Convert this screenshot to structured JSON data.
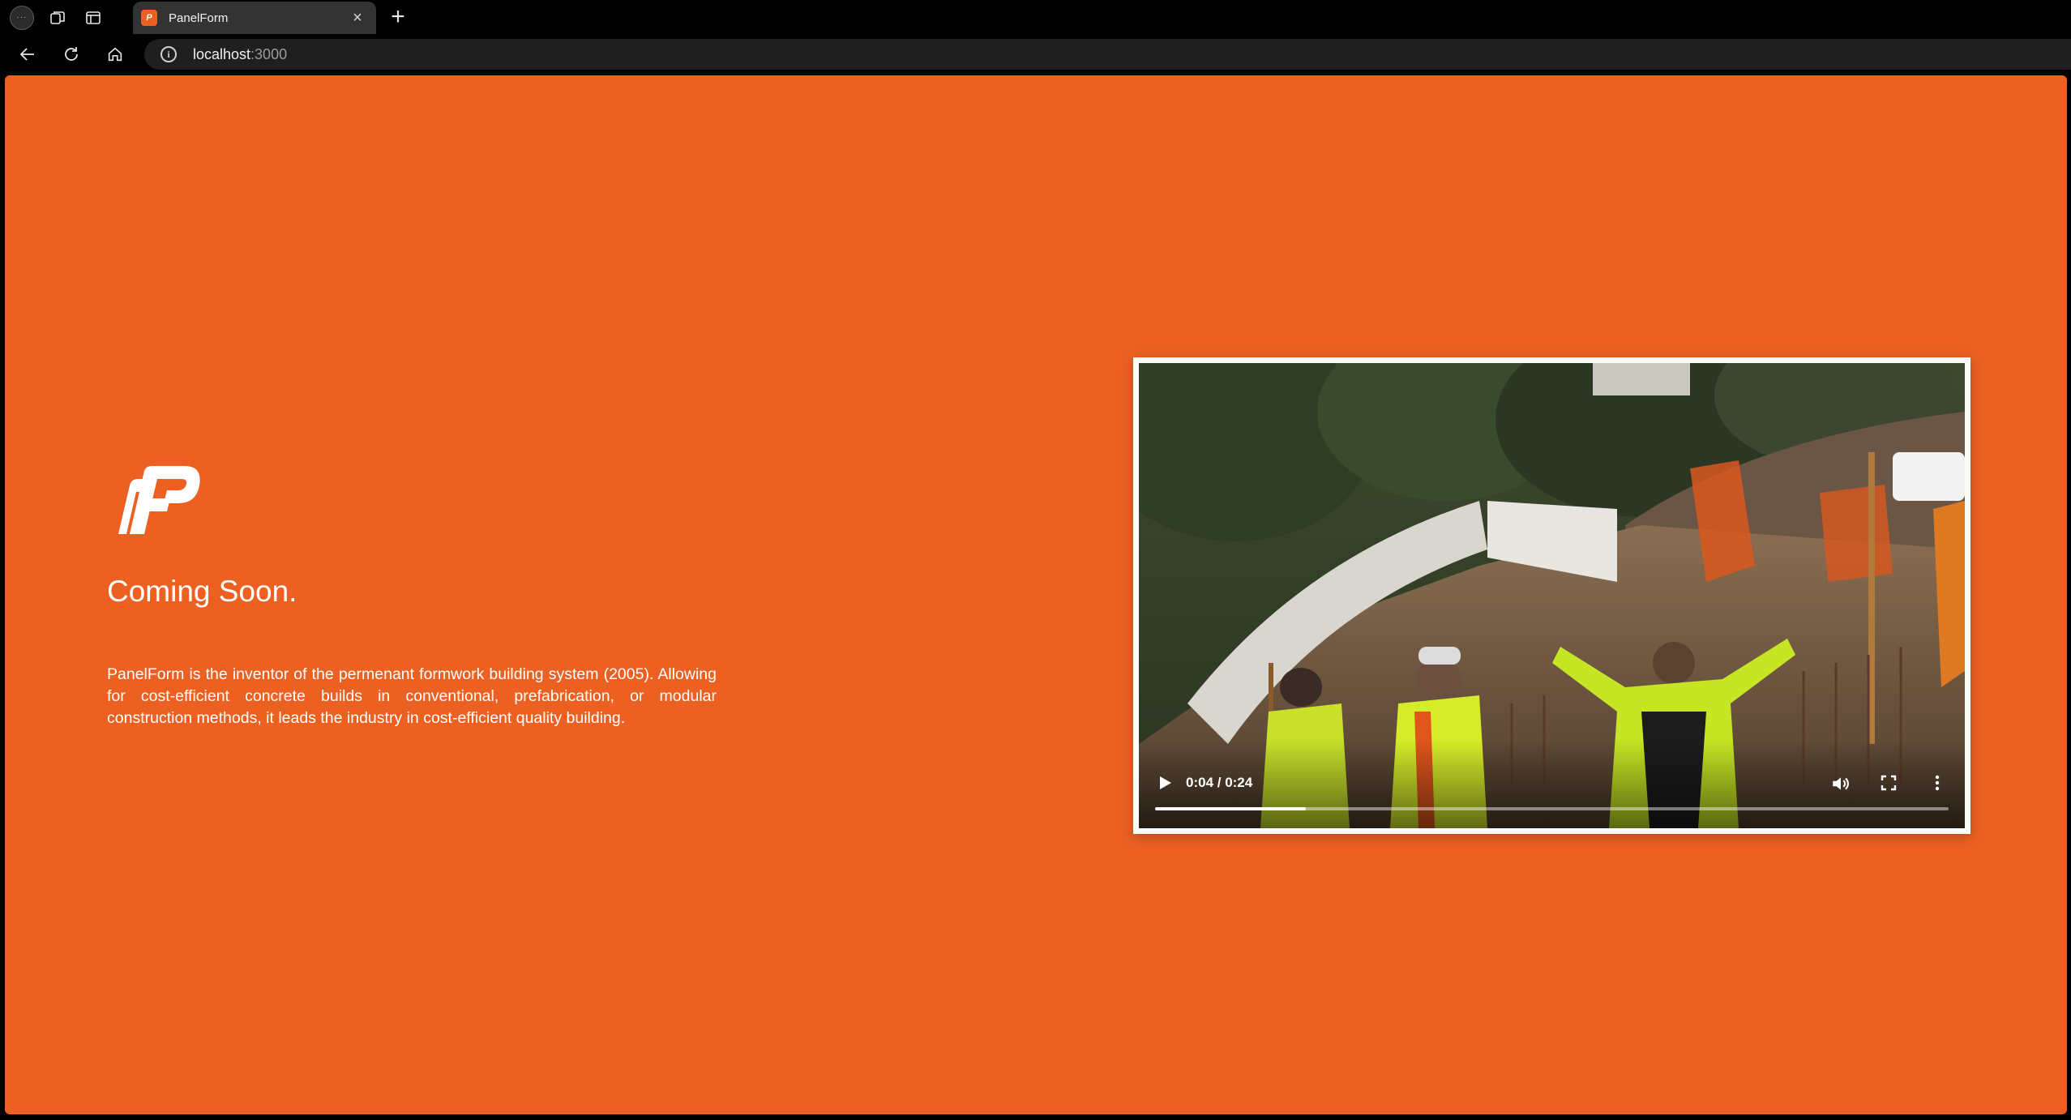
{
  "browser": {
    "tab": {
      "title": "PanelForm",
      "favicon": "panelform-logo-icon"
    },
    "new_tab_symbol": "+",
    "close_symbol": "×",
    "url": {
      "host": "localhost",
      "port": ":3000"
    }
  },
  "page": {
    "background_color": "#ec6122",
    "headline": "Coming Soon.",
    "description": "PanelForm is the inventor of the permenant formwork building system (2005). Allowing for cost-efficient concrete builds in conventional, prefabrication, or modular construction methods, it leads the industry in cost-efficient quality building.",
    "logo": "panelform-logo"
  },
  "video": {
    "current_time": "0:04",
    "duration": "0:24",
    "time_display": "0:04 / 0:24",
    "progress": 0.19,
    "content": "construction site with workers in high-visibility vests"
  }
}
